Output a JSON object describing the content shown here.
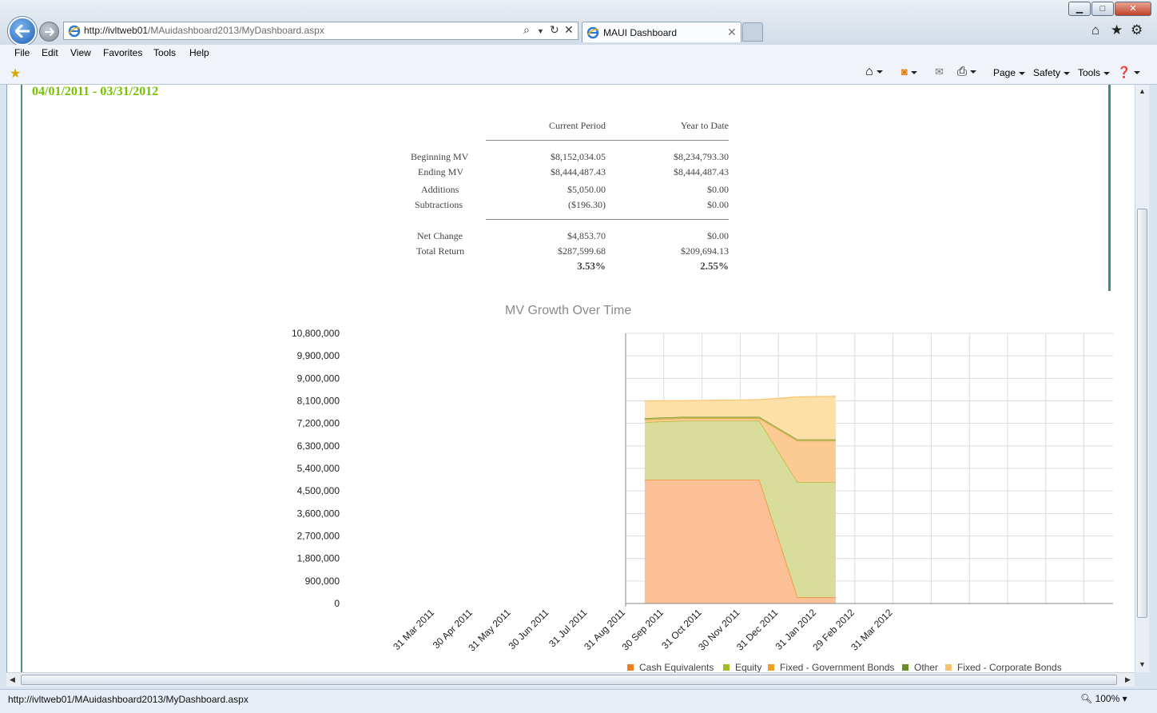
{
  "browser": {
    "address_host": "http://ivltweb01",
    "address_path": "/MAuidashboard2013/MyDashboard.aspx",
    "tab_title": "MAUI Dashboard",
    "status_url": "http://ivltweb01/MAuidashboard2013/MyDashboard.aspx",
    "zoom": "100%"
  },
  "menu": {
    "file": "File",
    "edit": "Edit",
    "view": "View",
    "favorites": "Favorites",
    "tools": "Tools",
    "help": "Help"
  },
  "commandbar": {
    "page": "Page",
    "safety": "Safety",
    "tools": "Tools"
  },
  "report": {
    "date_range": "04/01/2011 - 03/31/2012",
    "columns": [
      "Current Period",
      "Year to Date"
    ],
    "rows": {
      "beginning_mv": {
        "label": "Beginning MV",
        "current": "$8,152,034.05",
        "ytd": "$8,234,793.30"
      },
      "ending_mv": {
        "label": "Ending MV",
        "current": "$8,444,487.43",
        "ytd": "$8,444,487.43"
      },
      "additions": {
        "label": "Additions",
        "current": "$5,050.00",
        "ytd": "$0.00"
      },
      "subtractions": {
        "label": "Subtractions",
        "current": "($196.30)",
        "ytd": "$0.00"
      },
      "net_change": {
        "label": "Net Change",
        "current": "$4,853.70",
        "ytd": "$0.00"
      },
      "total_return": {
        "label": "Total Return",
        "current": "$287,599.68",
        "ytd": "$209,694.13"
      }
    },
    "return_pct": {
      "current": "3.53%",
      "ytd": "2.55%"
    }
  },
  "chart_data": {
    "type": "area",
    "title": "MV Growth Over Time",
    "ylim": [
      0,
      10800000
    ],
    "y_ticks": [
      "10,800,000",
      "9,900,000",
      "9,000,000",
      "8,100,000",
      "7,200,000",
      "6,300,000",
      "5,400,000",
      "4,500,000",
      "3,600,000",
      "2,700,000",
      "1,800,000",
      "900,000",
      "0"
    ],
    "categories": [
      "31 Mar 2011",
      "30 Apr 2011",
      "31 May 2011",
      "30 Jun 2011",
      "31 Jul 2011",
      "31 Aug 2011",
      "30 Sep 2011",
      "31 Oct 2011",
      "30 Nov 2011",
      "31 Dec 2011",
      "31 Jan 2012",
      "29 Feb 2012",
      "31 Mar 2012"
    ],
    "stacked": true,
    "grid": true,
    "legend": "bottom",
    "series": [
      {
        "name": "Cash Equivalents",
        "color": "#f07c1e",
        "fill": "#fbc096",
        "x": [
          "30 Sep 2011",
          "31 Oct 2011",
          "30 Nov 2011",
          "31 Dec 2011",
          "31 Jan 2012",
          "29 Feb 2012"
        ],
        "values": [
          4950000,
          4950000,
          4950000,
          4950000,
          250000,
          250000
        ]
      },
      {
        "name": "Equity",
        "color": "#a3b92a",
        "fill": "#d8dd9c",
        "x": [
          "30 Sep 2011",
          "31 Oct 2011",
          "30 Nov 2011",
          "31 Dec 2011",
          "31 Jan 2012",
          "29 Feb 2012"
        ],
        "values": [
          2300000,
          2350000,
          2350000,
          2350000,
          4600000,
          4600000
        ]
      },
      {
        "name": "Fixed - Government Bonds",
        "color": "#f0a020",
        "fill": "#fccb94",
        "x": [
          "30 Sep 2011",
          "31 Oct 2011",
          "30 Nov 2011",
          "31 Dec 2011",
          "31 Jan 2012",
          "29 Feb 2012"
        ],
        "values": [
          100000,
          100000,
          100000,
          100000,
          1650000,
          1650000
        ]
      },
      {
        "name": "Other",
        "color": "#6b8e23",
        "fill": "#b9c06a",
        "x": [
          "30 Sep 2011",
          "31 Oct 2011",
          "30 Nov 2011",
          "31 Dec 2011",
          "31 Jan 2012",
          "29 Feb 2012"
        ],
        "values": [
          60000,
          60000,
          60000,
          60000,
          60000,
          60000
        ]
      },
      {
        "name": "Fixed - Corporate Bonds",
        "color": "#f9c36d",
        "fill": "#fde0a8",
        "x": [
          "30 Sep 2011",
          "31 Oct 2011",
          "30 Nov 2011",
          "31 Dec 2011",
          "31 Jan 2012",
          "29 Feb 2012"
        ],
        "values": [
          690000,
          650000,
          670000,
          690000,
          1700000,
          1720000
        ]
      }
    ]
  }
}
